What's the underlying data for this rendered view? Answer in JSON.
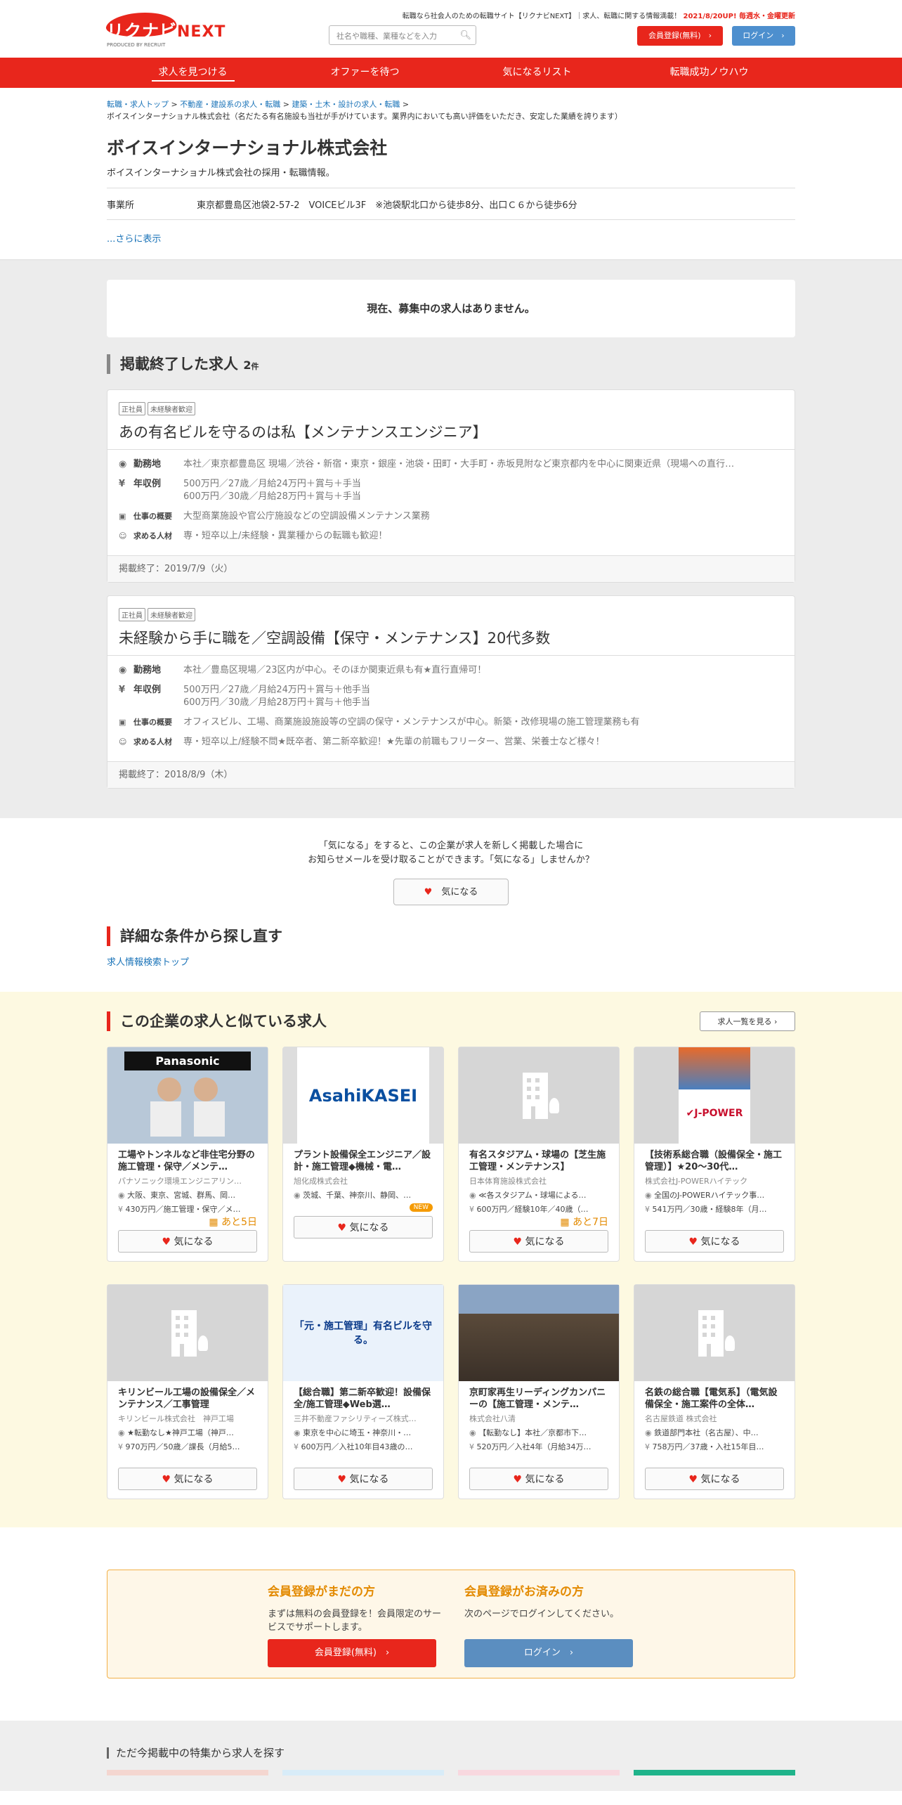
{
  "header": {
    "logo_text": "リクナビ",
    "logo_next": "NEXT",
    "logo_sub": "PRODUCED BY RECRUIT",
    "tagline": "転職なら社会人のための転職サイト【リクナビNEXT】｜求人、転職に関する情報満載！",
    "update_note": "2021/8/20UP! 毎週水・金曜更新",
    "search_placeholder": "社名や職種、業種などを入力",
    "register_label": "会員登録(無料)",
    "login_label": "ログイン"
  },
  "nav": [
    "求人を見つける",
    "オファーを待つ",
    "気になるリスト",
    "転職成功ノウハウ"
  ],
  "breadcrumb": {
    "items": [
      "転職・求人トップ",
      "不動産・建設系の求人・転職",
      "建築・土木・設計の求人・転職"
    ],
    "current": "ボイスインターナショナル株式会社（名だたる有名施設も当社が手がけています。業界内においても高い評価をいただき、安定した業績を誇ります）"
  },
  "company": {
    "name": "ボイスインターナショナル株式会社",
    "subtitle": "ボイスインターナショナル株式会社の採用・転職情報。",
    "office_label": "事業所",
    "office_value": "東京都豊島区池袋2-57-2　VOICEビル3F　※池袋駅北口から徒歩8分、出口Ｃ６から徒歩6分",
    "more_link": "...さらに表示"
  },
  "no_jobs_message": "現在、募集中の求人はありません。",
  "ended": {
    "title": "掲載終了した求人",
    "count": "2",
    "unit": "件",
    "labels": {
      "location": "勤務地",
      "salary": "年収例",
      "summary": "仕事の概要",
      "wanted": "求める人材"
    },
    "jobs": [
      {
        "tags": [
          "正社員",
          "未経験者歓迎"
        ],
        "title": "あの有名ビルを守るのは私【メンテナンスエンジニア】",
        "location": "本社／東京都豊島区 現場／渋谷・新宿・東京・銀座・池袋・田町・大手町・赤坂見附など東京都内を中心に関東近県（現場への直行…",
        "salary1": "500万円／27歳／月給24万円＋賞与＋手当",
        "salary2": "600万円／30歳／月給28万円＋賞与＋手当",
        "summary": "大型商業施設や官公庁施設などの空調設備メンテナンス業務",
        "wanted": "専・短卒以上/未経験・異業種からの転職も歓迎！",
        "ended": "掲載終了：2019/7/9（火）"
      },
      {
        "tags": [
          "正社員",
          "未経験者歓迎"
        ],
        "title": "未経験から手に職を／空調設備【保守・メンテナンス】20代多数",
        "location": "本社／豊島区現場／23区内が中心。そのほか関東近県も有★直行直帰可！",
        "salary1": "500万円／27歳／月給24万円＋賞与＋他手当",
        "salary2": "600万円／30歳／月給28万円＋賞与＋他手当",
        "summary": "オフィスビル、工場、商業施設施設等の空調の保守・メンテナンスが中心。新築・改修現場の施工管理業務も有",
        "wanted": "専・短卒以上/経験不問★既卒者、第二新卒歓迎！★先輩の前職もフリーター、営業、栄養士など様々！",
        "ended": "掲載終了：2018/8/9（木）"
      }
    ]
  },
  "favorite": {
    "line1": "「気になる」をすると、この企業が求人を新しく掲載した場合に",
    "line2": "お知らせメールを受け取ることができます。「気になる」しませんか？",
    "button": "気になる"
  },
  "retry": {
    "title": "詳細な条件から探し直す",
    "link": "求人情報検索トップ"
  },
  "similar": {
    "title": "この企業の求人と似ている求人",
    "list_button": "求人一覧を見る",
    "fav_label": "気になる",
    "cards": [
      {
        "title": "工場やトンネルなど非住宅分野の施工管理・保守／メンテ…",
        "company": "パナソニック環境エンジニアリン…",
        "loc": "大阪、東京、宮城、群馬、岡…",
        "sal": "430万円／施工管理・保守／メ…",
        "extra": "あと5日",
        "img": "Panasonic"
      },
      {
        "title": "プラント設備保全エンジニア／設計・施工管理◆機械・電…",
        "company": "旭化成株式会社",
        "loc": "茨城、千葉、神奈川、静岡、…",
        "sal": "",
        "extra": "NEW",
        "img": "AsahiKASEI"
      },
      {
        "title": "有名スタジアム・球場の【芝生施工管理・メンテナンス】",
        "company": "日本体育施設株式会社",
        "loc": "≪各スタジアム・球場による…",
        "sal": "600万円／経験10年／40歳（…",
        "extra": "あと7日",
        "img": ""
      },
      {
        "title": "【技術系総合職（設備保全・施工管理）】★20～30代…",
        "company": "株式会社J-POWERハイテック",
        "loc": "全国のJ-POWERハイテック事…",
        "sal": "541万円／30歳・経験8年（月…",
        "extra": "",
        "img": "J-POWER"
      },
      {
        "title": "キリンビール工場の設備保全／メンテナンス／工事管理",
        "company": "キリンビール株式会社　神戸工場",
        "loc": "★転勤なし★神戸工場（神戸…",
        "sal": "970万円／50歳／課長（月給5…",
        "extra": "",
        "img": ""
      },
      {
        "title": "【総合職】第二新卒歓迎！設備保全/施工管理◆Web選…",
        "company": "三井不動産ファシリティーズ株式…",
        "loc": "東京を中心に埼玉・神奈川・…",
        "sal": "600万円／入社10年目43歳の…",
        "extra": "",
        "img": "「元・施工管理」有名ビルを守る。"
      },
      {
        "title": "京町家再生リーディングカンパニーの【施工管理・メンテ…",
        "company": "株式会社八清",
        "loc": "【転勤なし】本社／京都市下…",
        "sal": "520万円／入社4年（月給34万…",
        "extra": "",
        "img": ""
      },
      {
        "title": "名鉄の総合職【電気系】（電気設備保全・施工案件の全体…",
        "company": "名古屋鉄道 株式会社",
        "loc": "鉄道部門本社（名古屋）、中…",
        "sal": "758万円／37歳・入社15年目…",
        "extra": "",
        "img": ""
      }
    ]
  },
  "member": {
    "left_title": "会員登録がまだの方",
    "left_text": "まずは無料の会員登録を！会員限定のサービスでサポートします。",
    "left_button": "会員登録(無料)",
    "right_title": "会員登録がお済みの方",
    "right_text": "次のページでログインしてください。",
    "right_button": "ログイン"
  },
  "feature_title": "ただ今掲載中の特集から求人を探す",
  "colors": {
    "brand": "#e8261c",
    "login": "#4d8fce",
    "accent": "#e38a00"
  }
}
